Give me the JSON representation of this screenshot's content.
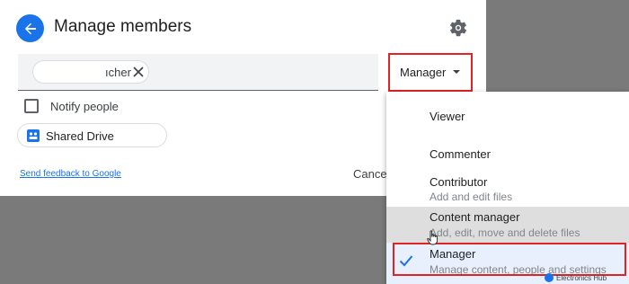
{
  "dialog": {
    "title": "Manage members",
    "member_chip": {
      "visible_text": "ıcher"
    },
    "role_select": {
      "value": "Manager"
    },
    "notify": {
      "label": "Notify people",
      "checked": false
    },
    "drive_chip": {
      "label": "Shared Drive"
    },
    "feedback_link": "Send feedback to Google",
    "cancel_label": "Cancel"
  },
  "menu": {
    "items": [
      {
        "label": "Viewer",
        "description": ""
      },
      {
        "label": "Commenter",
        "description": ""
      },
      {
        "label": "Contributor",
        "description": "Add and edit files"
      },
      {
        "label": "Content manager",
        "description": "Add, edit, move and delete files"
      },
      {
        "label": "Manager",
        "description": "Manage content, people and settings",
        "selected": true
      }
    ]
  },
  "watermark": {
    "text": "Electronics Hub"
  },
  "colors": {
    "accent": "#1a73e8",
    "highlight_border": "#e02424",
    "backdrop": "#7a7a7a"
  }
}
